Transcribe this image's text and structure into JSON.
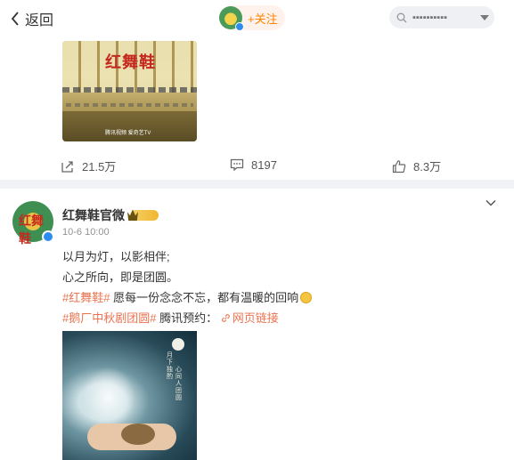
{
  "header": {
    "back_label": "返回",
    "follow_label": "+关注",
    "search_placeholder": "▪▪▪▪▪▪▪▪▪▪"
  },
  "post1": {
    "poster_logo": "红舞鞋",
    "poster_platforms": "腾讯视频 爱奇艺TV",
    "repost_count": "21.5万",
    "comment_count": "8197",
    "like_count": "8.3万"
  },
  "post2": {
    "avatar_text": "红舞鞋",
    "author": "红舞鞋官微",
    "time": "10-6 10:00",
    "line1": "以月为灯，以影相伴;",
    "line2": "心之所向，即是团圆。",
    "tag1": "#红舞鞋#",
    "line3_text": " 愿每一份念念不忘，都有温暖的回响",
    "tag2": "#鹅厂中秋剧团圆#",
    "line4_text": " 腾讯预约：",
    "link_label": "网页链接",
    "poster_vertical_text": "月下独酌",
    "poster_vertical_text2": "心同人团圆"
  },
  "colors": {
    "accent": "#eb7350",
    "follow": "#ff8200",
    "verified": "#2d8cf0",
    "background": "#f1f2f5"
  },
  "icons": [
    "back-chevron-icon",
    "search-icon",
    "dropdown-caret-icon",
    "repost-icon",
    "comment-icon",
    "like-icon",
    "more-chevron-icon",
    "link-icon",
    "emoji-icon"
  ]
}
